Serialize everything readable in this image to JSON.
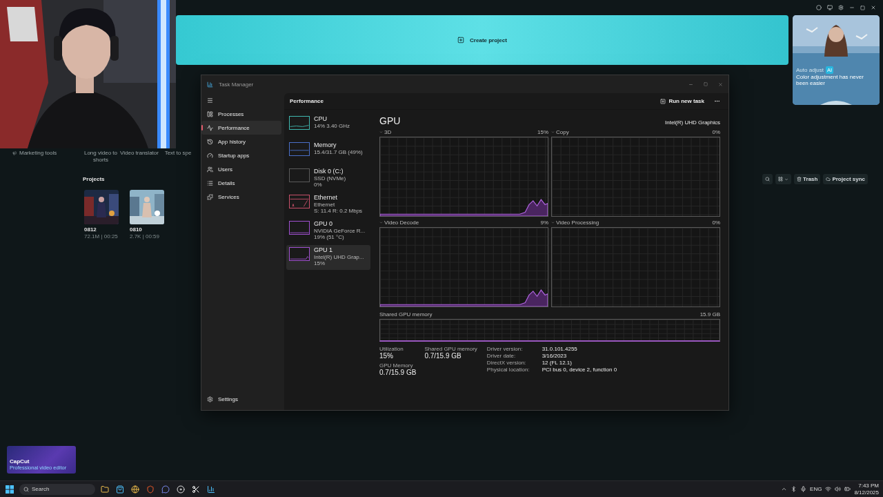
{
  "capcut": {
    "banner": {
      "label": "Create project"
    },
    "promo": {
      "title": "Auto adjust",
      "badge": "AI",
      "text": "Color adjustment has never been easier"
    },
    "tools": [
      "Marketing tools",
      "Long video to shorts",
      "Video translator",
      "Text to spe"
    ],
    "projects_title": "Projects",
    "toolbar": {
      "trash": "Trash",
      "sync": "Project sync"
    },
    "projects": [
      {
        "name": "0812",
        "meta": "72.1M | 00:25"
      },
      {
        "name": "0810",
        "meta": "2.7K | 00:59"
      }
    ],
    "app_card": {
      "title": "CapCut",
      "subtitle": "Professional video editor"
    }
  },
  "task_manager": {
    "title": "Task Manager",
    "nav": [
      {
        "label": "Processes",
        "selected": false
      },
      {
        "label": "Performance",
        "selected": true
      },
      {
        "label": "App history",
        "selected": false
      },
      {
        "label": "Startup apps",
        "selected": false
      },
      {
        "label": "Users",
        "selected": false
      },
      {
        "label": "Details",
        "selected": false
      },
      {
        "label": "Services",
        "selected": false
      }
    ],
    "settings": "Settings",
    "header": "Performance",
    "run_task": "Run new task",
    "resources": [
      {
        "name": "CPU",
        "lines": [
          "14% 3.40 GHz"
        ],
        "selected": false,
        "color": "#3fb8b0"
      },
      {
        "name": "Memory",
        "lines": [
          "15.4/31.7 GB (49%)"
        ],
        "selected": false,
        "color": "#4a6fc8"
      },
      {
        "name": "Disk 0 (C:)",
        "lines": [
          "SSD (NVMe)",
          "0%"
        ],
        "selected": false,
        "color": "#5a5a5a"
      },
      {
        "name": "Ethernet",
        "lines": [
          "Ethernet",
          "S: 11.4 R: 0.2 Mbps"
        ],
        "selected": false,
        "color": "#c8506a"
      },
      {
        "name": "GPU 0",
        "lines": [
          "NVIDIA GeForce R...",
          "19% (51 °C)"
        ],
        "selected": false,
        "color": "#a050d0"
      },
      {
        "name": "GPU 1",
        "lines": [
          "Intel(R) UHD Grap...",
          "15%"
        ],
        "selected": true,
        "color": "#a050d0"
      }
    ],
    "gpu": {
      "title": "GPU",
      "adapter": "Intel(R) UHD Graphics",
      "engines": [
        {
          "name": "3D",
          "value": "15%",
          "busy": true
        },
        {
          "name": "Copy",
          "value": "0%",
          "busy": false
        },
        {
          "name": "Video Decode",
          "value": "9%",
          "busy": true
        },
        {
          "name": "Video Processing",
          "value": "0%",
          "busy": false
        }
      ],
      "shared_label": "Shared GPU memory",
      "shared_max": "15.9 GB",
      "stats": [
        {
          "label": "Utilization",
          "value": "15%"
        },
        {
          "label": "Shared GPU memory",
          "value": "0.7/15.9 GB"
        },
        {
          "label": "GPU Memory",
          "value": "0.7/15.9 GB"
        }
      ],
      "details": [
        {
          "label": "Driver version:",
          "value": "31.0.101.4255"
        },
        {
          "label": "Driver date:",
          "value": "3/16/2023"
        },
        {
          "label": "DirectX version:",
          "value": "12 (FL 12.1)"
        },
        {
          "label": "Physical location:",
          "value": "PCI bus 0, device 2, function 0"
        }
      ]
    }
  },
  "taskbar": {
    "search": "Search",
    "language": "ENG",
    "time": "7:43 PM",
    "date": "8/12/2025"
  }
}
